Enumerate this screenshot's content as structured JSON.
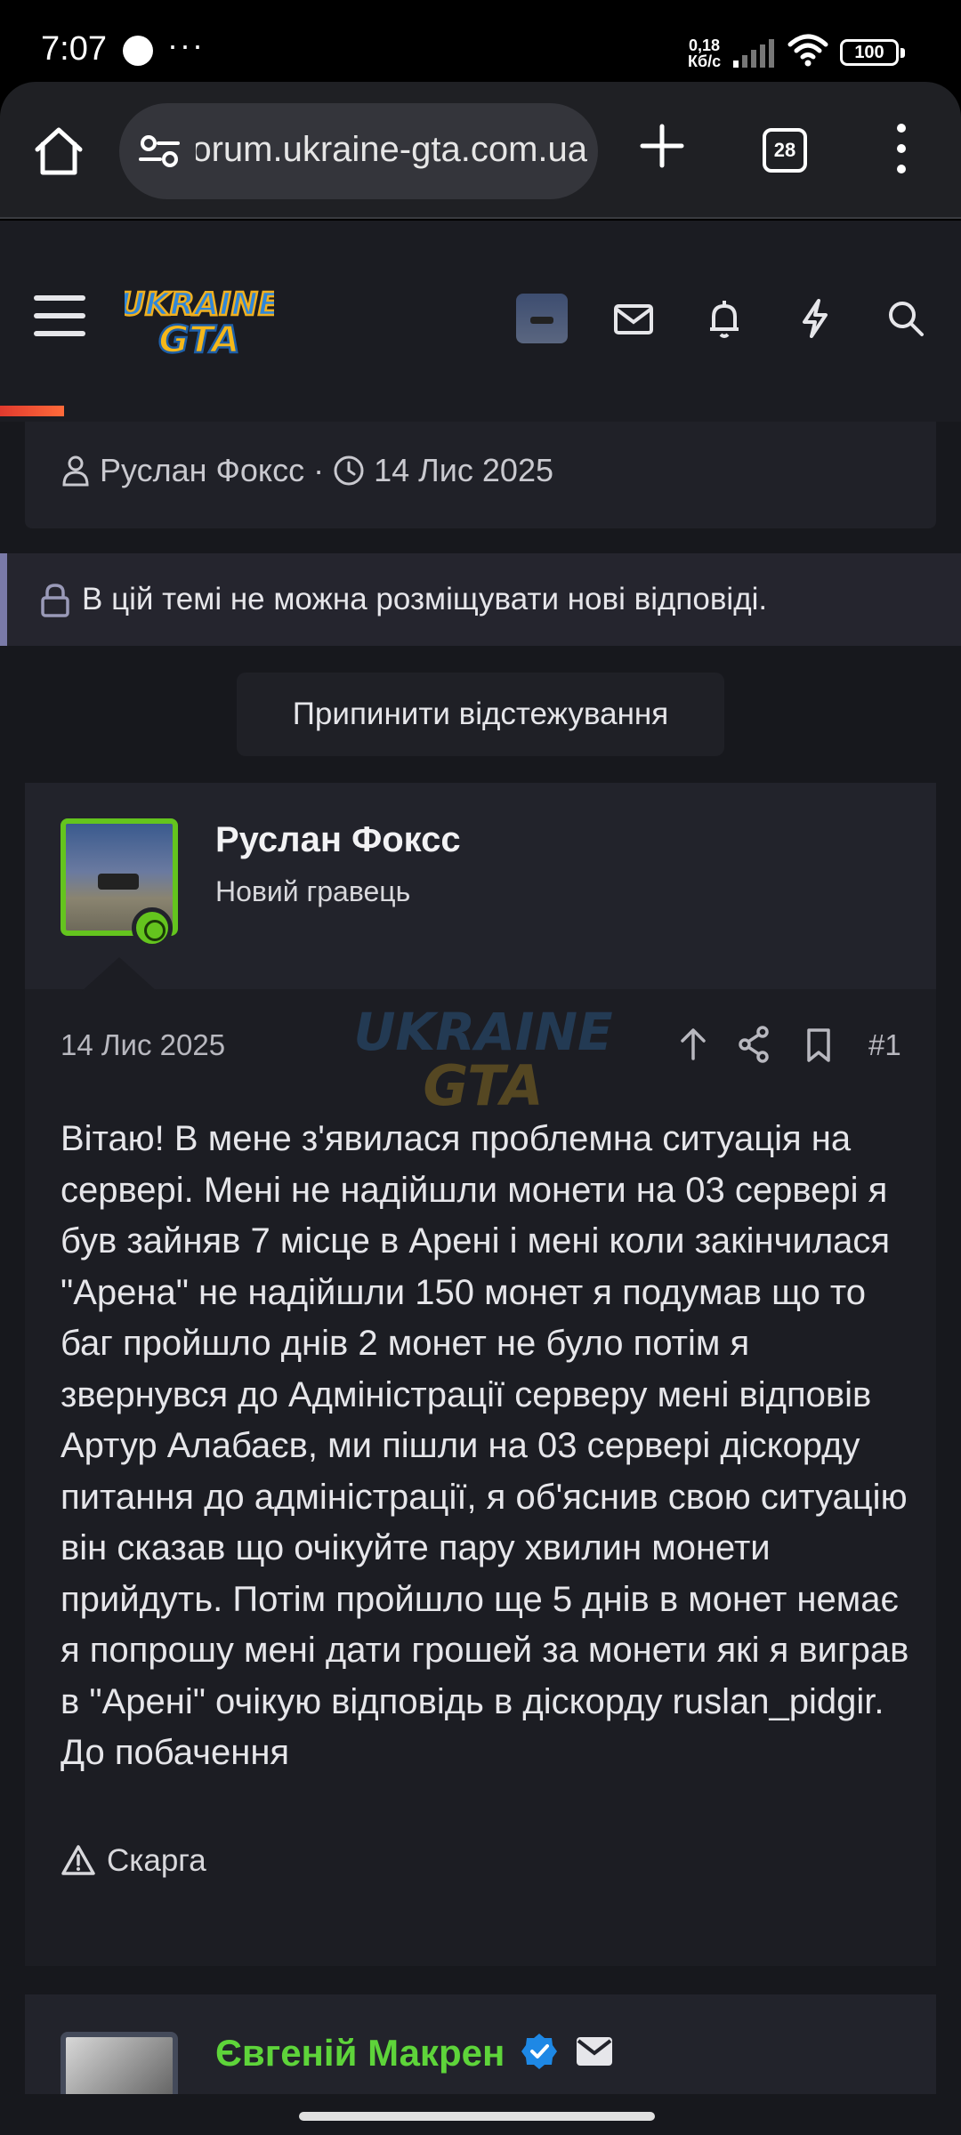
{
  "status_bar": {
    "time": "7:07",
    "dots": "···",
    "net_speed_value": "0,18",
    "net_speed_unit": "Кб/с",
    "battery": "100",
    "icons": [
      "skull-icon",
      "signal-icon",
      "wifi-icon",
      "battery-icon"
    ]
  },
  "browser": {
    "url": "forum.ukraine-gta.com.ua",
    "tab_count": "28",
    "icons": [
      "home-icon",
      "site-settings-icon",
      "new-tab-icon",
      "tabs-icon",
      "more-menu-icon"
    ]
  },
  "site_header": {
    "logo_line1": "UKRAINE",
    "logo_line2": "GTA",
    "icons": [
      "menu-icon",
      "user-avatar",
      "mail-icon",
      "bell-icon",
      "bolt-icon",
      "search-icon"
    ],
    "page_progress": 0.07
  },
  "thread_meta": {
    "author": "Руслан Фоксс",
    "separator": "·",
    "date": "14 Лис 2025"
  },
  "locked_notice": "В цій темі не можна розміщувати нові відповіді.",
  "unwatch_button": "Припинити відстежування",
  "post": {
    "username": "Руслан Фоксс",
    "user_title": "Новий гравець",
    "date": "14 Лис 2025",
    "number": "#1",
    "body": "Вітаю! В мене з'явилася проблемна ситуація на сервері. Мені не надійшли монети на 03 сервері я був зайняв 7 місце в Арені і мені коли закінчилася \"Арена\" не надійшли 150 монет я подумав що то баг пройшло днів 2 монет не було потім я звернувся до Адміністрації серверу мені відповів Артур Алабаєв, ми пішли на 03 сервері діскорду питання до адміністрації, я об'яснив свою ситуацію він сказав що очікуйте пару хвилин монети прийдуть. Потім пройшло ще 5 днів в монет немає я попрошу мені дати грошей за монети які я виграв в \"Арені\" очікую відповідь в діскорду ruslan_pidgir. До побачення",
    "report_label": "Скарга"
  },
  "next_post": {
    "username": "Євгеній Макрен"
  },
  "colors": {
    "accent_green": "#64c41e",
    "name_green": "#5ed43a",
    "notice_border": "#7a7aa8",
    "progress": "#e03a2e",
    "verified_blue": "#1e88e5"
  }
}
